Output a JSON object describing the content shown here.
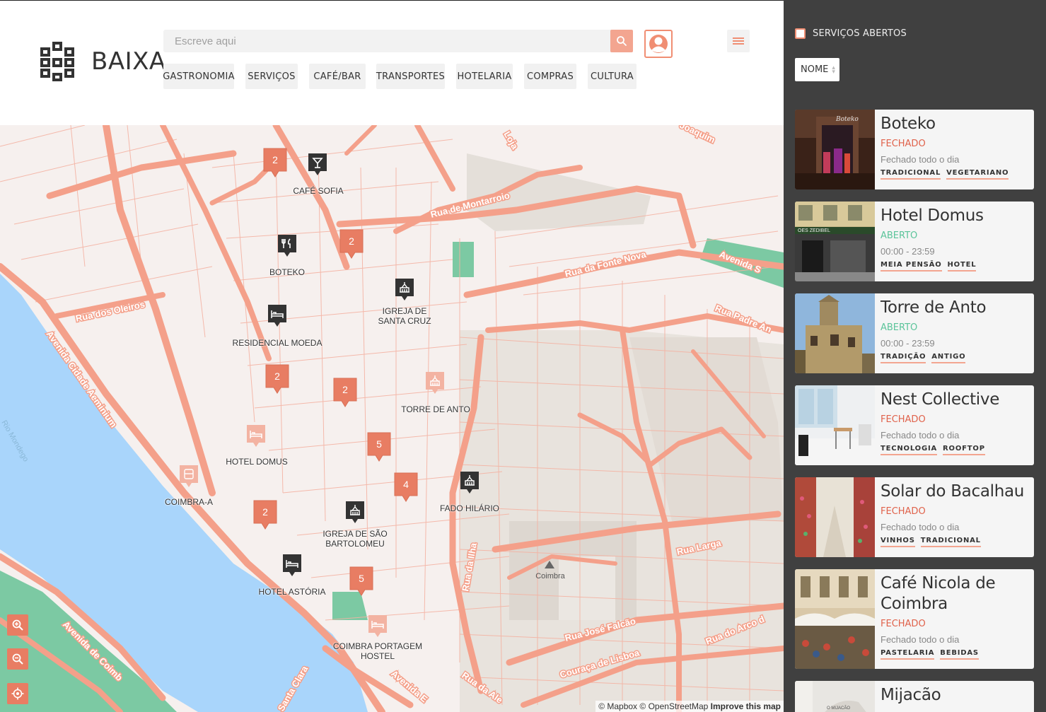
{
  "brand": {
    "name": "BAIXA"
  },
  "search": {
    "placeholder": "Escreve aqui"
  },
  "categories": [
    "GASTRONOMIA",
    "SERVIÇOS",
    "CAFÉ/BAR",
    "TRANSPORTES",
    "HOTELARIA",
    "COMPRAS",
    "CULTURA"
  ],
  "filters": {
    "open_services_label": "SERVIÇOS ABERTOS",
    "open_services_checked": false,
    "sort_value": "NOME"
  },
  "map": {
    "clusters": [
      "2",
      "2",
      "2",
      "2",
      "5",
      "4",
      "2",
      "5"
    ],
    "places": {
      "cafe_sofia": "CAFÉ SOFIA",
      "boteko": "BOTEKO",
      "igreja_santa_cruz": "IGREJA DE\nSANTA CRUZ",
      "residencial_moeda": "RESIDENCIAL MOEDA",
      "torre_de_anto": "TORRE DE ANTO",
      "hotel_domus": "HOTEL DOMUS",
      "coimbra_a": "COIMBRA-A",
      "fado_hilario": "FADO HILÁRIO",
      "igreja_sao_bartolomeu": "IGREJA DE SÃO\nBARTOLOMEU",
      "hotel_astoria": "HOTEL ASTÓRIA",
      "coimbra_portagem": "COIMBRA PORTAGEM\nHOSTEL",
      "coimbra_peak": "Coimbra"
    },
    "streets": {
      "montarroio": "Rua de Montarroio",
      "fonte_nova": "Rua da Fonte Nova",
      "oleiros": "Rua dos Oleiros",
      "aeminium": "Avenida Cidade Aeminium",
      "padre": "Rua Padre An",
      "avenida_s": "Avenida S",
      "larga": "Rua Larga",
      "jose_falcao": "Rua José Falcão",
      "couraca": "Couraça de Lisboa",
      "arco": "Rua do Arco d",
      "ilha": "Rua da Ilha",
      "coimbra_av": "Avenida de Coimb",
      "santa_clara": "Santa Clara",
      "avenida_e": "Avenida E",
      "alegre": "Rua da Ale",
      "joaquim": "Joaquim",
      "loja": "Loja",
      "mondego": "Rio Mondego"
    },
    "attribution": {
      "mapbox": "© Mapbox",
      "osm": "© OpenStreetMap",
      "improve": "Improve this map"
    }
  },
  "colors": {
    "accent": "#f08e73",
    "road": "#f4a08a",
    "water": "#a9d5fb",
    "park": "#7cc9a3",
    "sidebar_bg": "#404040",
    "closed": "#e0624b",
    "open": "#5bc49a"
  },
  "cards": [
    {
      "title": "Boteko",
      "status": "FECHADO",
      "status_type": "closed",
      "hours": "Fechado todo o dia",
      "tags": [
        "TRADICIONAL",
        "VEGETARIANO"
      ]
    },
    {
      "title": "Hotel Domus",
      "status": "ABERTO",
      "status_type": "open",
      "hours": "00:00 - 23:59",
      "tags": [
        "MEIA PENSÃO",
        "HOTEL"
      ]
    },
    {
      "title": "Torre de Anto",
      "status": "ABERTO",
      "status_type": "open",
      "hours": "00:00 - 23:59",
      "tags": [
        "TRADIÇÃO",
        "ANTIGO"
      ]
    },
    {
      "title": "Nest Collective",
      "status": "FECHADO",
      "status_type": "closed",
      "hours": "Fechado todo o dia",
      "tags": [
        "TECNOLOGIA",
        "ROOFTOP"
      ]
    },
    {
      "title": "Solar do Bacalhau",
      "status": "FECHADO",
      "status_type": "closed",
      "hours": "Fechado todo o dia",
      "tags": [
        "VINHOS",
        "TRADICIONAL"
      ]
    },
    {
      "title": "Café Nicola de Coimbra",
      "status": "FECHADO",
      "status_type": "closed",
      "hours": "Fechado todo o dia",
      "tags": [
        "PASTELARIA",
        "BEBIDAS"
      ]
    },
    {
      "title": "Mijacão",
      "status": "",
      "status_type": "",
      "hours": "",
      "tags": []
    }
  ]
}
